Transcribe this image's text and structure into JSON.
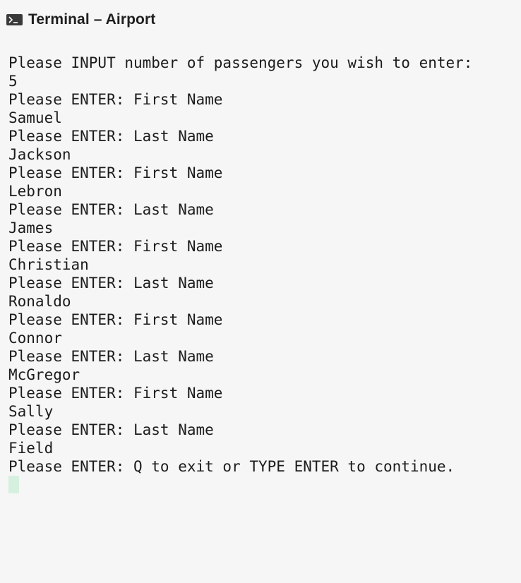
{
  "window": {
    "title": "Terminal – Airport",
    "icon": "terminal-icon"
  },
  "terminal": {
    "lines": [
      "Please INPUT number of passengers you wish to enter:",
      "5",
      "Please ENTER: First Name",
      "Samuel",
      "Please ENTER: Last Name",
      "Jackson",
      "Please ENTER: First Name",
      "Lebron",
      "Please ENTER: Last Name",
      "James",
      "Please ENTER: First Name",
      "Christian",
      "Please ENTER: Last Name",
      "Ronaldo",
      "Please ENTER: First Name",
      "Connor",
      "Please ENTER: Last Name",
      "McGregor",
      "Please ENTER: First Name",
      "Sally",
      "Please ENTER: Last Name",
      "Field",
      "Please ENTER: Q to exit or TYPE ENTER to continue."
    ]
  },
  "colors": {
    "background": "#f6f6f6",
    "text": "#1c1c1c",
    "cursor": "#d6f0df"
  }
}
